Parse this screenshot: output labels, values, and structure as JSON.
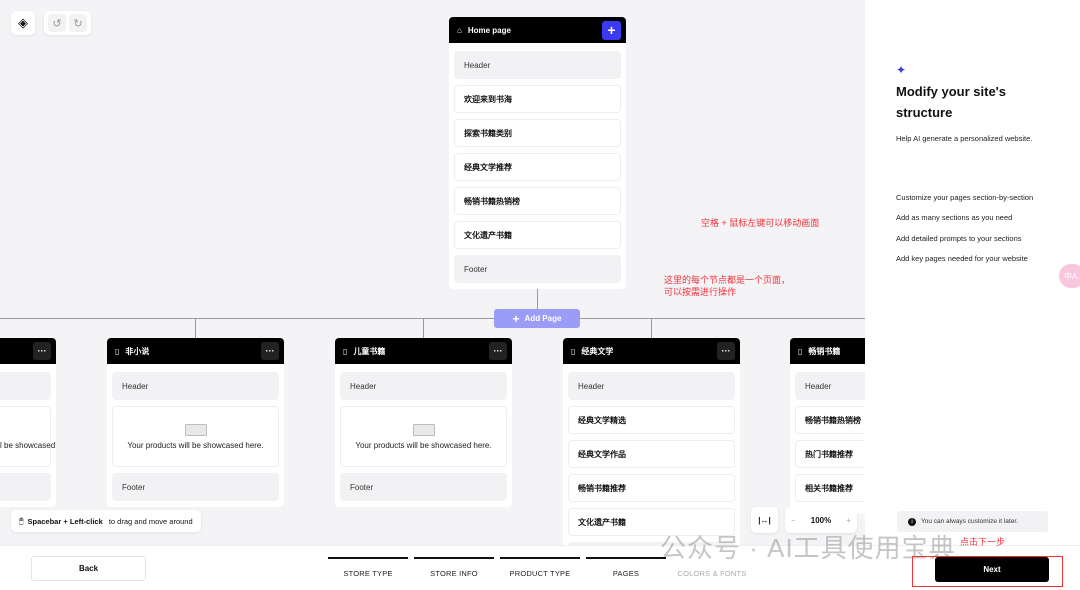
{
  "toolbar": {
    "logo_icon": "diamond-logo-icon",
    "undo_icon": "undo-icon",
    "redo_icon": "redo-icon"
  },
  "home_card": {
    "title": "Home page",
    "add_icon": "plus-icon",
    "sections": [
      "Header",
      "欢迎来到书海",
      "探索书籍类别",
      "经典文学推荐",
      "畅销书籍热销榜",
      "文化遗产书籍",
      "Footer"
    ]
  },
  "add_page": {
    "label": "Add Page"
  },
  "child_pages": [
    {
      "title": "",
      "sections": [
        "",
        "",
        ""
      ],
      "product_text": "Your products will be showcased here."
    },
    {
      "title": "非小说",
      "sections": [
        "Header",
        "Footer"
      ],
      "product_text": "Your products will be showcased here."
    },
    {
      "title": "儿童书籍",
      "sections": [
        "Header",
        "Footer"
      ],
      "product_text": "Your products will be showcased here."
    },
    {
      "title": "经典文学",
      "sections": [
        "Header",
        "经典文学精选",
        "经典文学作品",
        "畅销书籍推荐",
        "文化遗产书籍",
        ""
      ]
    },
    {
      "title": "畅销书籍",
      "sections": [
        "Header",
        "畅销书籍热销榜",
        "热门书籍推荐",
        "相关书籍推荐"
      ]
    }
  ],
  "hint": {
    "bold": "Spacebar + Left-click",
    "rest": " to drag and move around"
  },
  "zoom": {
    "level": "100%",
    "minus": "−",
    "plus": "+",
    "fit_label": "|↔|"
  },
  "annotations": {
    "pan": "空格 + 鼠标左键可以移动画面",
    "node_line1": "这里的每个节点都是一个页面，",
    "node_line2": "可以按需进行操作",
    "next": "点击下一步"
  },
  "panel": {
    "title": "Modify your site's structure",
    "subtitle": "Help AI generate a personalized website.",
    "features": [
      "Customize your pages section-by-section",
      "Add as many sections as you need",
      "Add detailed prompts to your sections",
      "Add key pages needed for your website"
    ],
    "notice": "You can always customize it later.",
    "translate_badge": "中A"
  },
  "footer": {
    "back": "Back",
    "next": "Next",
    "steps": [
      {
        "label": "STORE TYPE",
        "done": true
      },
      {
        "label": "STORE INFO",
        "done": true
      },
      {
        "label": "PRODUCT TYPE",
        "done": true
      },
      {
        "label": "PAGES",
        "done": true
      },
      {
        "label": "COLORS & FONTS",
        "done": false
      }
    ]
  },
  "watermark": "公众号 · AI工具使用宝典",
  "colors": {
    "accent": "#3a3af0",
    "add_page": "#9b9cf5",
    "annotation": "#f0323c"
  }
}
